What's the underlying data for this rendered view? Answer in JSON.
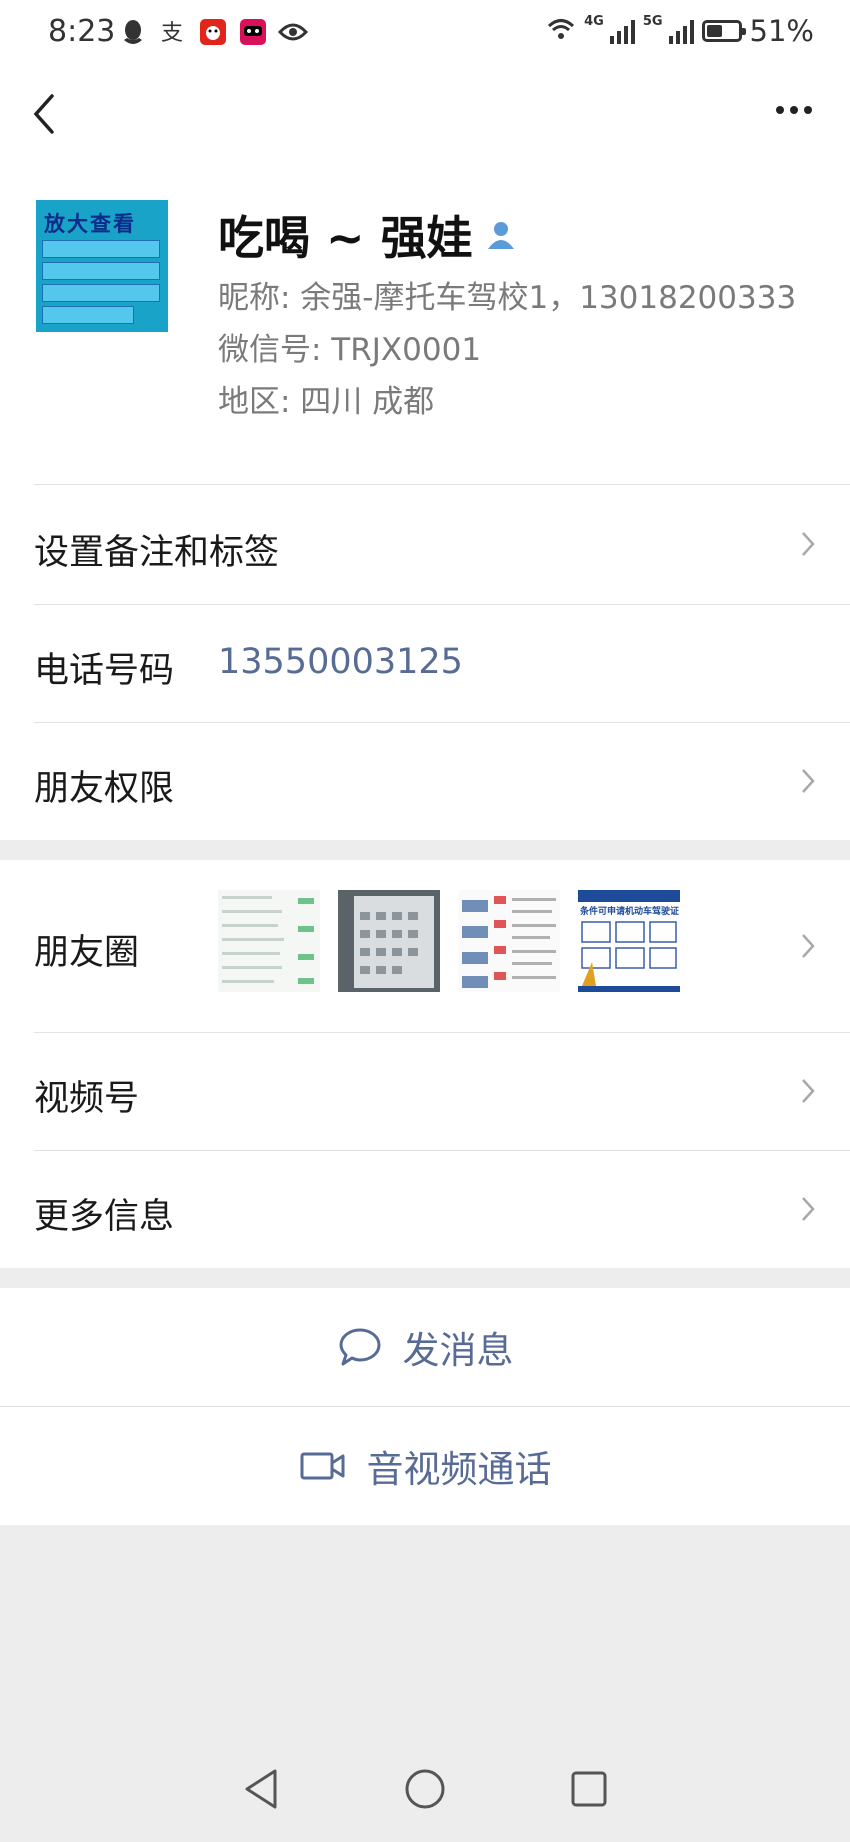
{
  "status_bar": {
    "time": "8:23",
    "left_icons": [
      "qq-icon",
      "alipay-icon",
      "jd-icon",
      "tmall-icon",
      "eye-icon"
    ],
    "network": [
      "4G",
      "5G"
    ],
    "battery": "51%",
    "battery_level": 0.51
  },
  "nav": {
    "back_icon": "chevron-left-icon",
    "more_icon": "more-horizontal-icon"
  },
  "profile": {
    "name": "吃喝 ~ 强娃",
    "nickname": "昵称:  余强-摩托车驾校1，13018200333",
    "wechat_id": "微信号:  TRJX0001",
    "region": "地区:  四川  成都",
    "avatar_text": "放大查看"
  },
  "rows": {
    "remark": "设置备注和标签",
    "phone_label": "电话号码",
    "phone_value": "13550003125",
    "permissions": "朋友权限",
    "moments": "朋友圈",
    "channels": "视频号",
    "more_info": "更多信息"
  },
  "moments_thumb_text": "条件可申请机动车驾驶证",
  "actions": {
    "message": "发消息",
    "call": "音视频通话"
  },
  "colors": {
    "link_blue": "#576b95",
    "background": "#ededed",
    "divider": "#e3e3e3"
  }
}
